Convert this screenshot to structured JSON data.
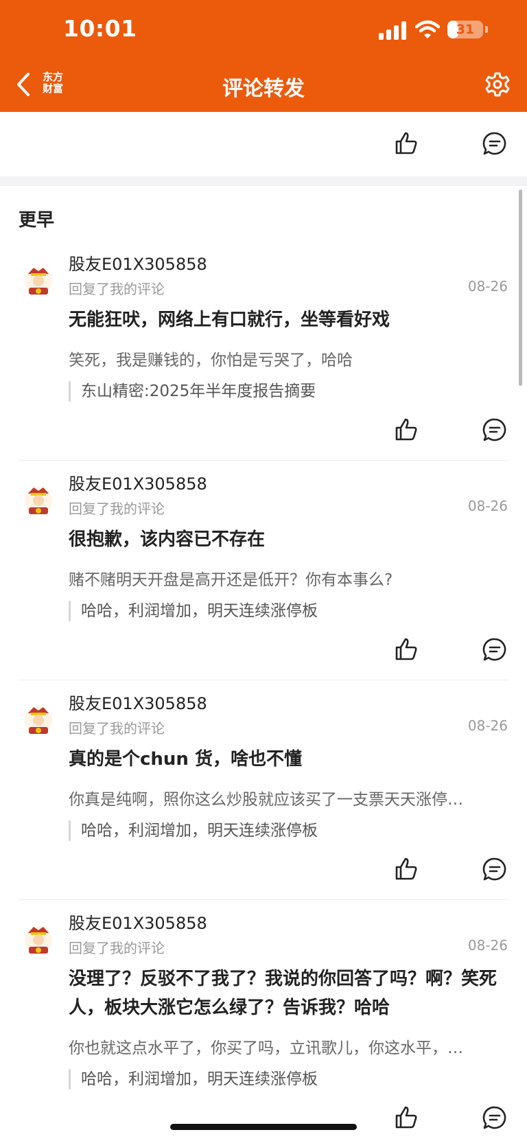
{
  "status_bar": {
    "time": "10:01",
    "battery": "31",
    "battery_level": 0.31
  },
  "header": {
    "brand": "东方财富",
    "brand_line1": "东方",
    "brand_line2": "财富",
    "title": "评论转发",
    "back_icon": "chevron-left-icon",
    "settings_icon": "gear-icon"
  },
  "colors": {
    "brand_orange": "#ec5a0c",
    "text_primary": "#222222",
    "text_secondary": "#999999"
  },
  "section": {
    "title": "更早"
  },
  "comments": [
    {
      "user": "股友E01X305858",
      "subtitle": "回复了我的评论",
      "date": "08-26",
      "text": "无能狂吠，网络上有口就行，坐等看好戏",
      "reply": "笑死，我是赚钱的，你怕是亏哭了，哈哈",
      "quote": "东山精密:2025年半年度报告摘要"
    },
    {
      "user": "股友E01X305858",
      "subtitle": "回复了我的评论",
      "date": "08-26",
      "text": "很抱歉，该内容已不存在",
      "reply": "赌不赌明天开盘是高开还是低开？你有本事么?",
      "quote": "哈哈，利润增加，明天连续涨停板"
    },
    {
      "user": "股友E01X305858",
      "subtitle": "回复了我的评论",
      "date": "08-26",
      "text": "真的是个chun 货，啥也不懂",
      "reply": "你真是纯啊，照你这么炒股就应该买了一支票天天涨停…",
      "quote": "哈哈，利润增加，明天连续涨停板"
    },
    {
      "user": "股友E01X305858",
      "subtitle": "回复了我的评论",
      "date": "08-26",
      "text": "没理了？反驳不了我了？我说的你回答了吗？啊？笑死人，板块大涨它怎么绿了？告诉我？哈哈",
      "reply": "你也就这点水平了，你买了吗，立讯歌儿，你这水平，…",
      "quote": "哈哈，利润增加，明天连续涨停板"
    }
  ]
}
